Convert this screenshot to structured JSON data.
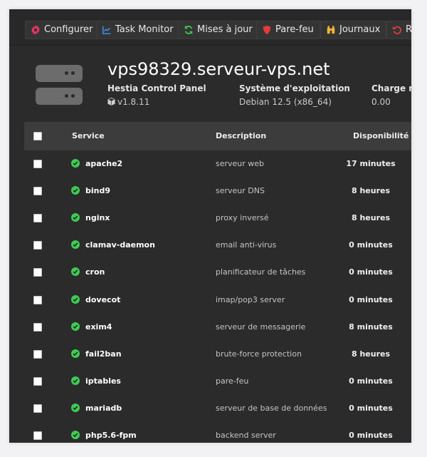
{
  "toolbar": {
    "buttons": [
      {
        "label": "Configurer",
        "icon": "gear-icon",
        "color": "#e8345e"
      },
      {
        "label": "Task Monitor",
        "icon": "chart-icon",
        "color": "#3b8fe6"
      },
      {
        "label": "Mises à jour",
        "icon": "refresh-icon",
        "color": "#3ecb55"
      },
      {
        "label": "Pare-feu",
        "icon": "shield-icon",
        "color": "#e23b3b"
      },
      {
        "label": "Journaux",
        "icon": "binoculars-icon",
        "color": "#f2b632"
      },
      {
        "label": "Re",
        "icon": "restart-icon",
        "color": "#e23b3b"
      }
    ]
  },
  "server": {
    "hostname": "vps98329.serveur-vps.net",
    "panel_label": "Hestia Control Panel",
    "panel_version": "v1.8.11",
    "os_label": "Système d'exploitation",
    "os_value": "Debian 12.5 (x86_64)",
    "load_label": "Charge mo",
    "load_value": "0.00"
  },
  "table": {
    "headers": {
      "service": "Service",
      "description": "Description",
      "uptime": "Disponibilité"
    },
    "status_color": "#3ecb55",
    "rows": [
      {
        "name": "apache2",
        "description": "serveur web",
        "uptime": "17 minutes"
      },
      {
        "name": "bind9",
        "description": "serveur DNS",
        "uptime": "8 heures"
      },
      {
        "name": "nginx",
        "description": "proxy inversé",
        "uptime": "8 heures"
      },
      {
        "name": "clamav-daemon",
        "description": "email anti-virus",
        "uptime": "0 minutes"
      },
      {
        "name": "cron",
        "description": "planificateur de tâches",
        "uptime": "0 minutes"
      },
      {
        "name": "dovecot",
        "description": "imap/pop3 server",
        "uptime": "0 minutes"
      },
      {
        "name": "exim4",
        "description": "serveur de messagerie",
        "uptime": "8 minutes"
      },
      {
        "name": "fail2ban",
        "description": "brute-force protection",
        "uptime": "8 heures"
      },
      {
        "name": "iptables",
        "description": "pare-feu",
        "uptime": "0 minutes"
      },
      {
        "name": "mariadb",
        "description": "serveur de base de données",
        "uptime": "0 minutes"
      },
      {
        "name": "php5.6-fpm",
        "description": "backend server",
        "uptime": "0 minutes"
      }
    ]
  }
}
